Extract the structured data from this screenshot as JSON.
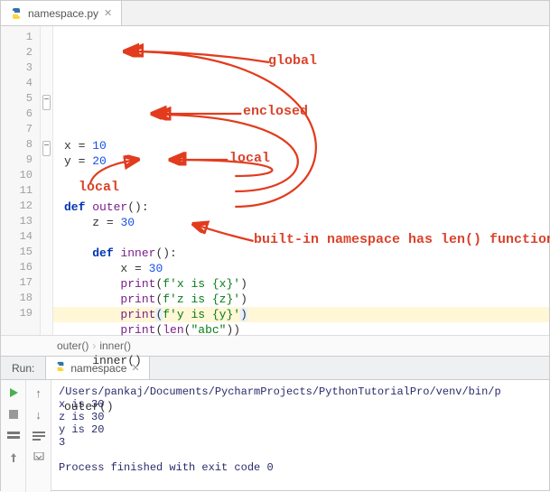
{
  "tab": {
    "filename": "namespace.py",
    "icon": "python-file-icon"
  },
  "code": {
    "lines": [
      {
        "n": 1,
        "indent": 0,
        "tokens": [
          [
            "id",
            "x"
          ],
          [
            "punct",
            " = "
          ],
          [
            "num",
            "10"
          ]
        ]
      },
      {
        "n": 2,
        "indent": 0,
        "tokens": [
          [
            "id",
            "y"
          ],
          [
            "punct",
            " = "
          ],
          [
            "num",
            "20"
          ]
        ]
      },
      {
        "n": 3,
        "indent": 0,
        "tokens": []
      },
      {
        "n": 4,
        "indent": 0,
        "tokens": []
      },
      {
        "n": 5,
        "indent": 0,
        "fold": true,
        "tokens": [
          [
            "kw",
            "def"
          ],
          [
            "punct",
            " "
          ],
          [
            "fn",
            "outer"
          ],
          [
            "punct",
            "():"
          ]
        ]
      },
      {
        "n": 6,
        "indent": 1,
        "tokens": [
          [
            "id",
            "z"
          ],
          [
            "punct",
            " = "
          ],
          [
            "num",
            "30"
          ]
        ]
      },
      {
        "n": 7,
        "indent": 0,
        "tokens": []
      },
      {
        "n": 8,
        "indent": 1,
        "fold": true,
        "tokens": [
          [
            "kw",
            "def"
          ],
          [
            "punct",
            " "
          ],
          [
            "fn",
            "inner"
          ],
          [
            "punct",
            "():"
          ]
        ]
      },
      {
        "n": 9,
        "indent": 2,
        "tokens": [
          [
            "id",
            "x"
          ],
          [
            "punct",
            " = "
          ],
          [
            "num",
            "30"
          ]
        ]
      },
      {
        "n": 10,
        "indent": 2,
        "tokens": [
          [
            "fn",
            "print"
          ],
          [
            "punct",
            "("
          ],
          [
            "str",
            "f'x is {x}'"
          ],
          [
            "punct",
            ")"
          ]
        ]
      },
      {
        "n": 11,
        "indent": 2,
        "tokens": [
          [
            "fn",
            "print"
          ],
          [
            "punct",
            "("
          ],
          [
            "str",
            "f'z is {z}'"
          ],
          [
            "punct",
            ")"
          ]
        ]
      },
      {
        "n": 12,
        "indent": 2,
        "hl": true,
        "tokens": [
          [
            "fn",
            "print"
          ],
          [
            "caret",
            "("
          ],
          [
            "str",
            "f'y is {y}'"
          ],
          [
            "caret",
            ")"
          ]
        ]
      },
      {
        "n": 13,
        "indent": 2,
        "tokens": [
          [
            "fn",
            "print"
          ],
          [
            "punct",
            "("
          ],
          [
            "fn",
            "len"
          ],
          [
            "punct",
            "("
          ],
          [
            "str",
            "\"abc\""
          ],
          [
            "punct",
            "))"
          ]
        ]
      },
      {
        "n": 14,
        "indent": 0,
        "tokens": []
      },
      {
        "n": 15,
        "indent": 1,
        "tokens": [
          [
            "id",
            "inner"
          ],
          [
            "punct",
            "()"
          ]
        ]
      },
      {
        "n": 16,
        "indent": 0,
        "tokens": []
      },
      {
        "n": 17,
        "indent": 0,
        "tokens": []
      },
      {
        "n": 18,
        "indent": 0,
        "tokens": [
          [
            "id",
            "outer"
          ],
          [
            "punct",
            "()"
          ]
        ]
      },
      {
        "n": 19,
        "indent": 0,
        "tokens": []
      }
    ]
  },
  "annotations": {
    "global": "global",
    "enclosed": "enclosed",
    "local1": "local",
    "local2": "local",
    "builtin": "built-in namespace has len() function"
  },
  "breadcrumb": {
    "items": [
      "outer()",
      "inner()"
    ],
    "sep": "›"
  },
  "run": {
    "label": "Run:",
    "tabName": "namespace",
    "console": [
      "/Users/pankaj/Documents/PycharmProjects/PythonTutorialPro/venv/bin/p",
      "x is 30",
      "z is 30",
      "y is 20",
      "3",
      "",
      "Process finished with exit code 0"
    ]
  }
}
